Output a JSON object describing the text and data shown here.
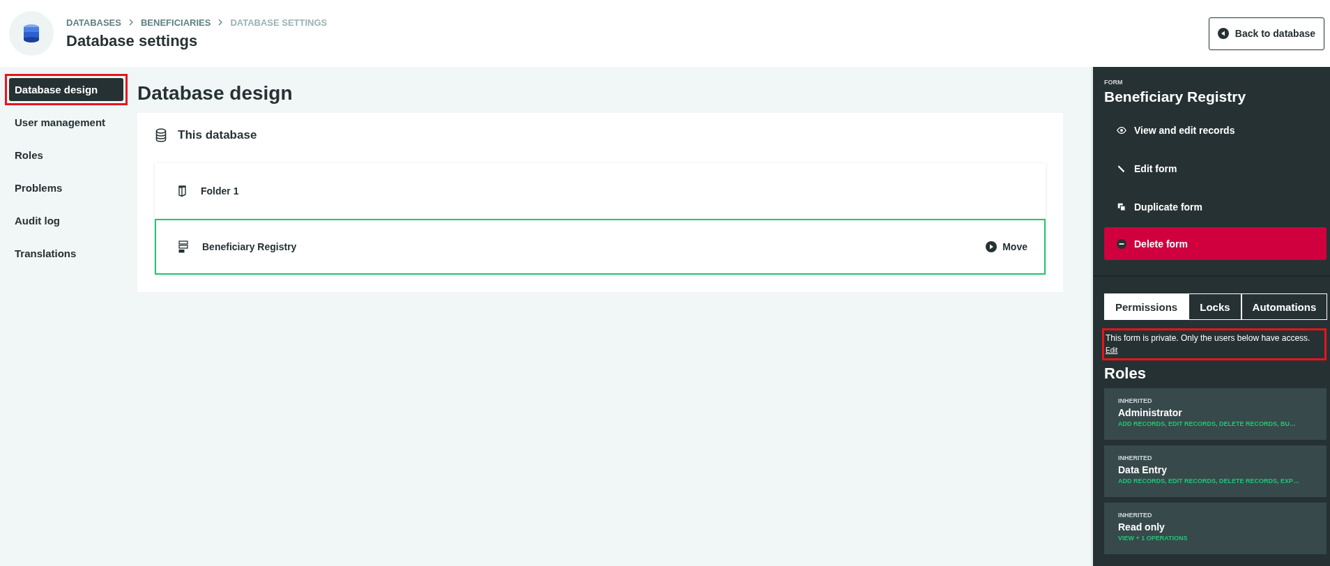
{
  "header": {
    "breadcrumbs": [
      {
        "label": "DATABASES",
        "current": false
      },
      {
        "label": "BENEFICIARIES",
        "current": false
      },
      {
        "label": "DATABASE SETTINGS",
        "current": true
      }
    ],
    "title": "Database settings",
    "back_button": "Back to database"
  },
  "sidebar": {
    "items": [
      {
        "label": "Database design",
        "selected": true,
        "highlighted": true
      },
      {
        "label": "User management",
        "selected": false,
        "highlighted": false
      },
      {
        "label": "Roles",
        "selected": false,
        "highlighted": false
      },
      {
        "label": "Problems",
        "selected": false,
        "highlighted": false
      },
      {
        "label": "Audit log",
        "selected": false,
        "highlighted": false
      },
      {
        "label": "Translations",
        "selected": false,
        "highlighted": false
      }
    ]
  },
  "main": {
    "title": "Database design",
    "section_title": "This database",
    "items": [
      {
        "kind": "folder",
        "label": "Folder 1",
        "selected": false
      },
      {
        "kind": "form",
        "label": "Beneficiary Registry",
        "selected": true,
        "action": "Move"
      }
    ]
  },
  "panel": {
    "overline": "FORM",
    "title": "Beneficiary Registry",
    "actions": [
      {
        "kind": "view",
        "label": "View and edit records"
      },
      {
        "kind": "edit",
        "label": "Edit form"
      },
      {
        "kind": "duplicate",
        "label": "Duplicate form"
      },
      {
        "kind": "delete",
        "label": "Delete form"
      }
    ],
    "tabs": [
      {
        "label": "Permissions",
        "selected": true
      },
      {
        "label": "Locks",
        "selected": false
      },
      {
        "label": "Automations",
        "selected": false
      }
    ],
    "notice": {
      "text": "This form is private. Only the users below have access.",
      "link": "Edit",
      "highlighted": true
    },
    "roles_title": "Roles",
    "roles": [
      {
        "tag": "INHERITED",
        "name": "Administrator",
        "permissions": "ADD RECORDS, EDIT RECORDS, DELETE RECORDS, BU…"
      },
      {
        "tag": "INHERITED",
        "name": "Data Entry",
        "permissions": "ADD RECORDS, EDIT RECORDS, DELETE RECORDS, EXP…"
      },
      {
        "tag": "INHERITED",
        "name": "Read only",
        "permissions": "VIEW + 1 OPERATIONS"
      }
    ]
  }
}
